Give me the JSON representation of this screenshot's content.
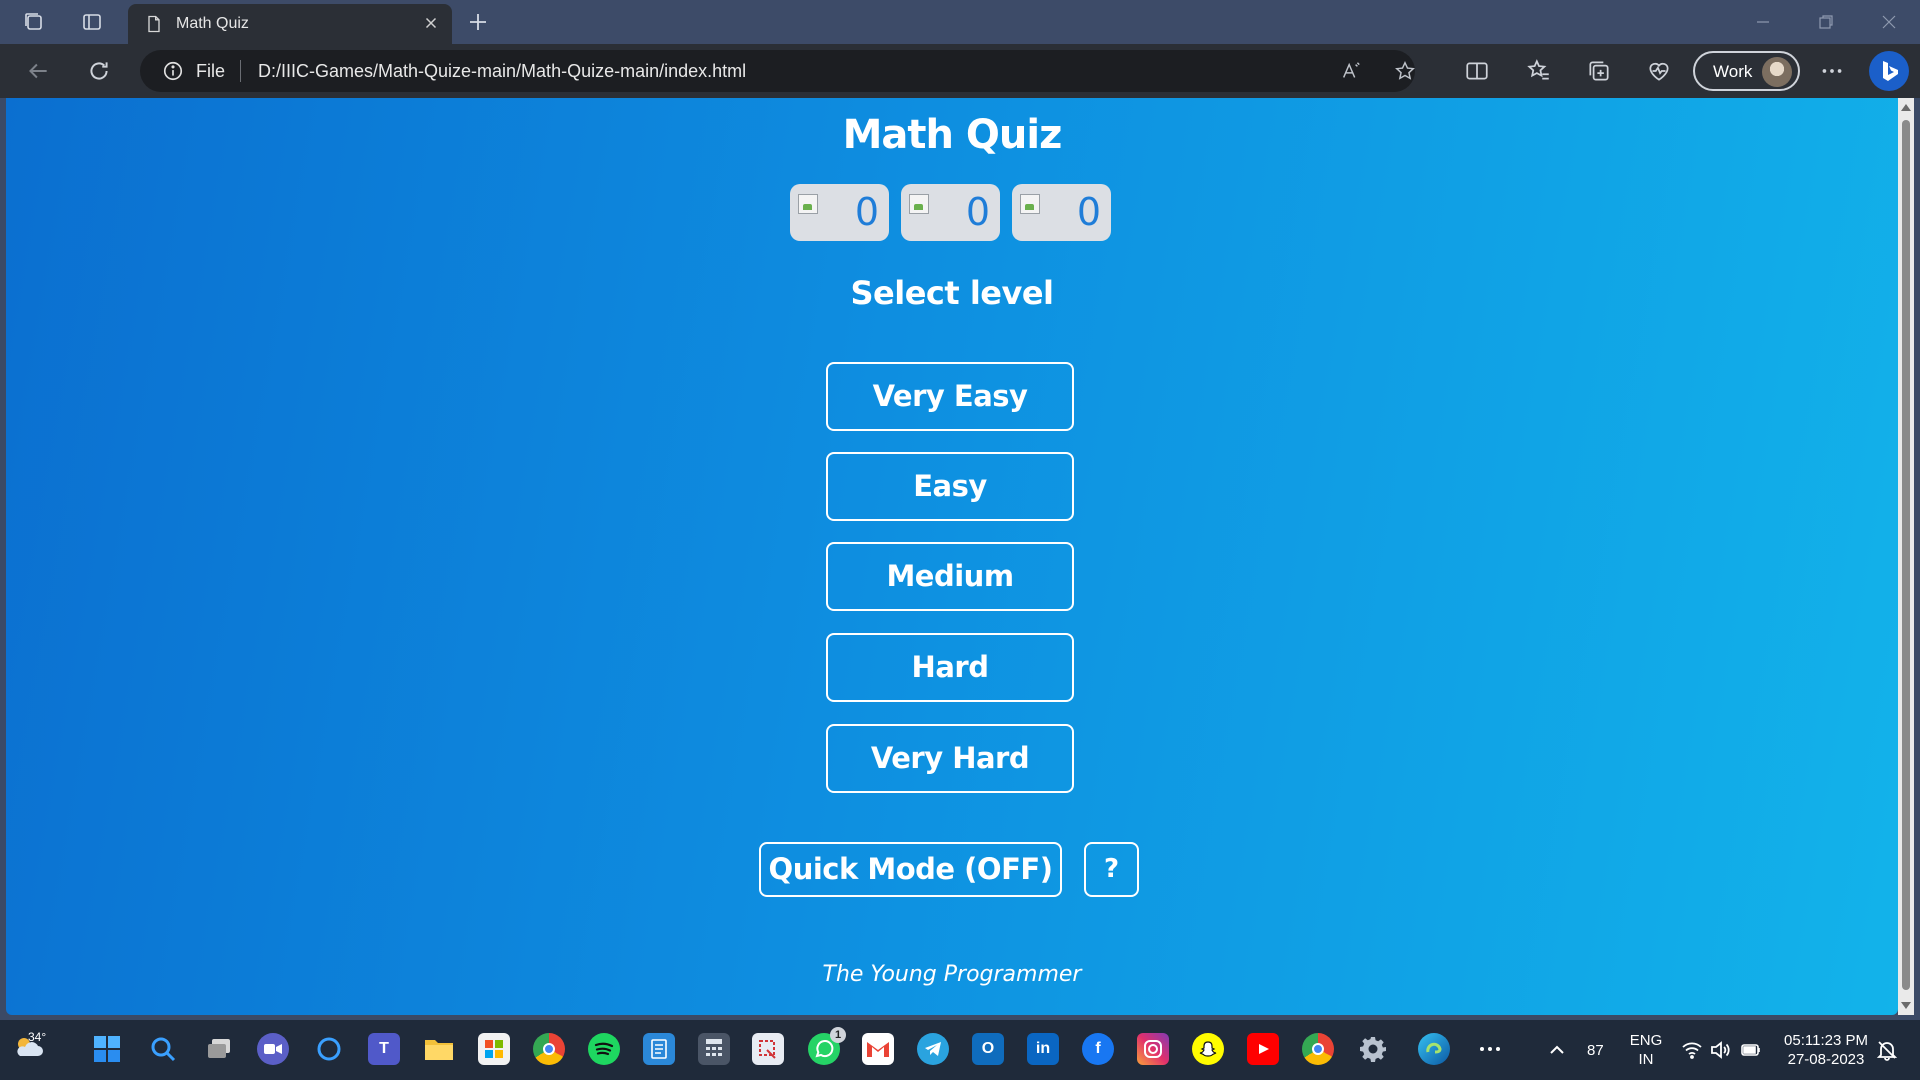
{
  "browser": {
    "tab_title": "Math Quiz",
    "address_scheme": "File",
    "url": "D:/IIIC-Games/Math-Quize-main/Math-Quize-main/index.html",
    "profile_label": "Work",
    "icons": [
      "workspaces-icon",
      "tab-actions-icon",
      "page-icon",
      "close-icon",
      "new-tab-icon",
      "back-icon",
      "refresh-icon",
      "info-icon",
      "read-aloud-icon",
      "favorite-star-icon",
      "split-screen-icon",
      "favorites-icon",
      "collections-icon",
      "browser-essentials-icon",
      "more-icon",
      "bing-chat-icon"
    ]
  },
  "quiz": {
    "title": "Math Quiz",
    "scores": [
      {
        "value": "0"
      },
      {
        "value": "0"
      },
      {
        "value": "0"
      }
    ],
    "select_label": "Select level",
    "levels": [
      "Very Easy",
      "Easy",
      "Medium",
      "Hard",
      "Very Hard"
    ],
    "quick_mode_label": "Quick Mode (OFF)",
    "help_label": "?",
    "footer": "The Young Programmer"
  },
  "taskbar": {
    "weather_temp": "34°",
    "whatsapp_badge": "1",
    "tray_value": "87",
    "lang_line1": "ENG",
    "lang_line2": "IN",
    "time": "05:11:23 PM",
    "date": "27-08-2023"
  },
  "colors": {
    "page_gradient_start": "#0b6fd0",
    "page_gradient_end": "#12b3ea",
    "score_text": "#1f7dd8",
    "chrome_bg": "#2b2f36",
    "titlebar_bg": "#3d4b68"
  }
}
